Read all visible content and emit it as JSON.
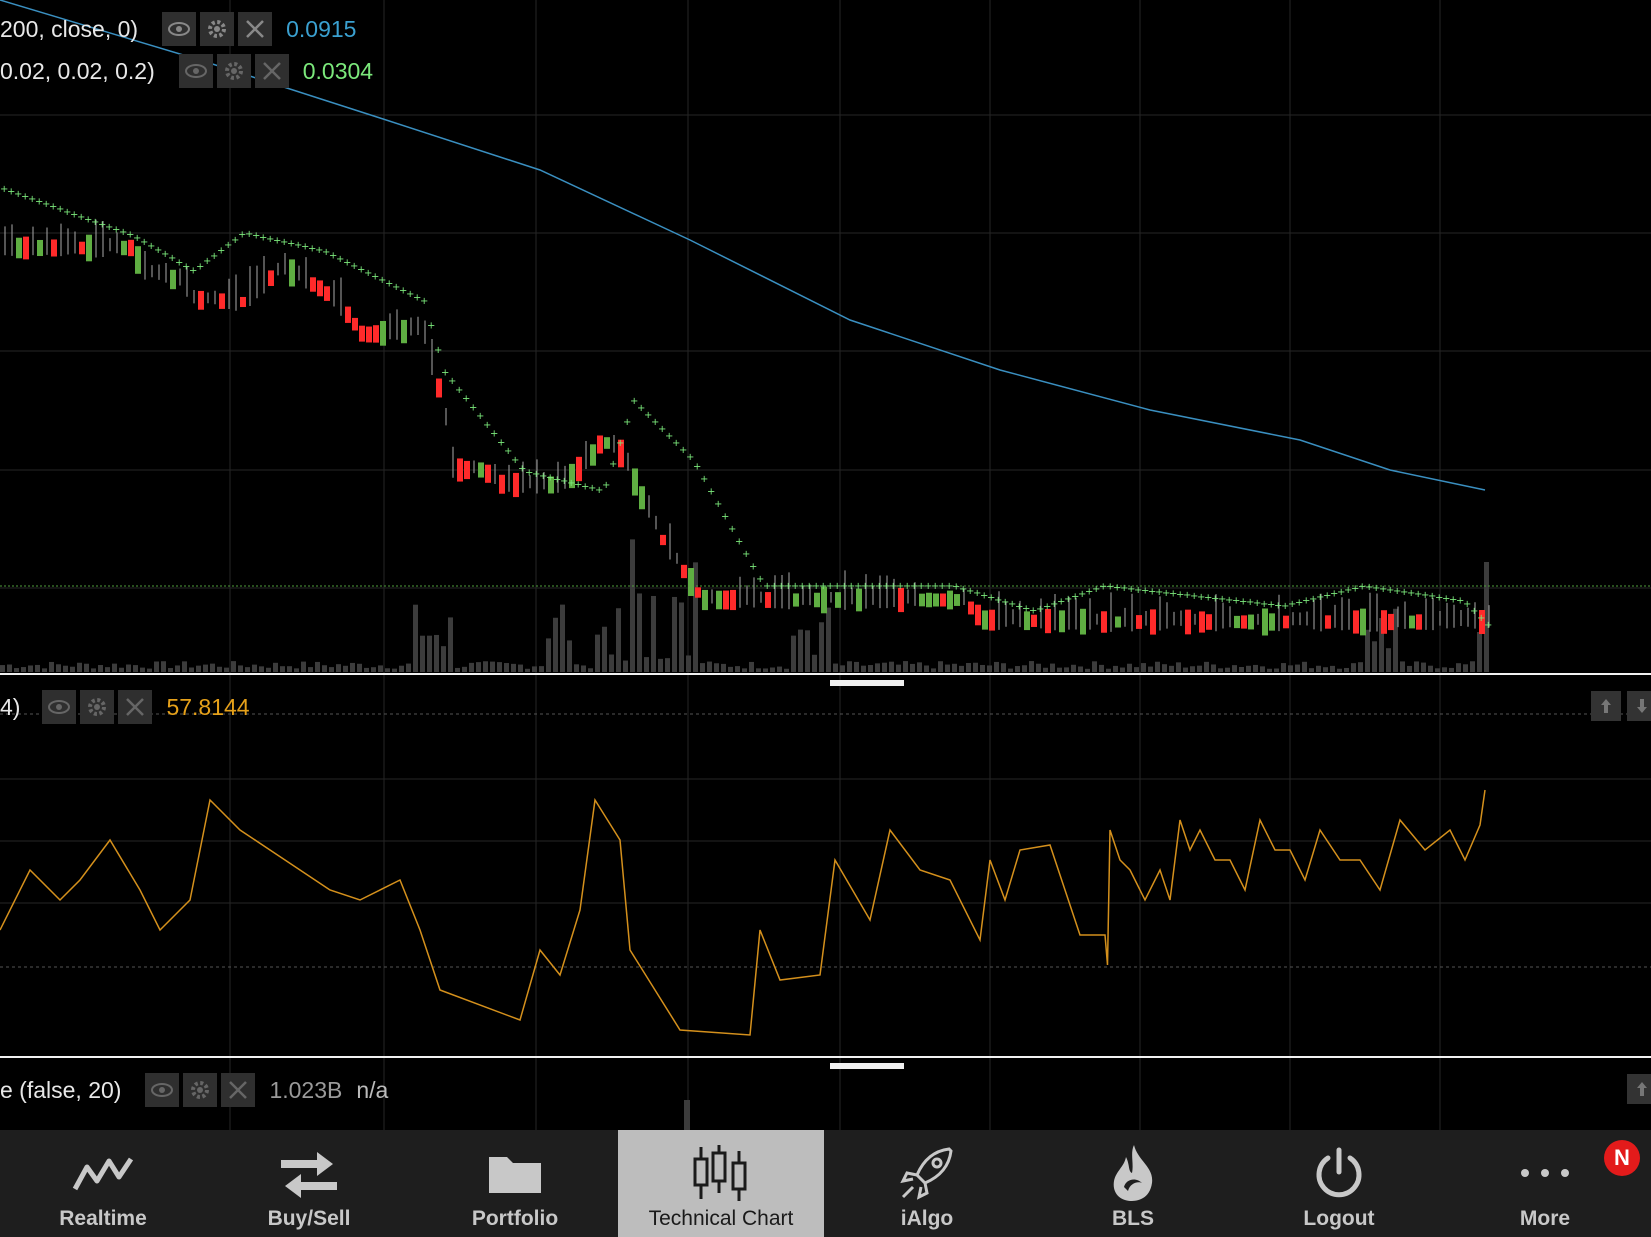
{
  "indicators": [
    {
      "label": "200, close, 0)",
      "value": "0.0915",
      "color": "#3aa0d0"
    },
    {
      "label": "0.02, 0.02, 0.2)",
      "value": "0.0304",
      "color": "#7be87b"
    },
    {
      "label": "4)",
      "value": "57.8144",
      "color": "#e6a11a"
    },
    {
      "label": "e (false, 20)",
      "value": "1.023B",
      "extra": "n/a",
      "color": "#9a9a9a"
    }
  ],
  "tabs": [
    {
      "label": "Realtime",
      "icon": "realtime-icon"
    },
    {
      "label": "Buy/Sell",
      "icon": "buy-sell-icon"
    },
    {
      "label": "Portfolio",
      "icon": "portfolio-icon"
    },
    {
      "label": "Technical Chart",
      "icon": "technical-chart-icon",
      "active": true
    },
    {
      "label": "iAlgo",
      "icon": "ialgo-icon"
    },
    {
      "label": "BLS",
      "icon": "bls-icon"
    },
    {
      "label": "Logout",
      "icon": "logout-icon"
    },
    {
      "label": "More",
      "icon": "more-icon",
      "badge": "N"
    }
  ],
  "colors": {
    "up": "#5fae42",
    "down": "#ff2a2a",
    "sma": "#3a8fc0",
    "sar": "#7be87b",
    "rsi": "#d4901c",
    "volume": "#3c3c3c",
    "grid": "#262626",
    "active_tab": "#bdbdbd"
  }
}
